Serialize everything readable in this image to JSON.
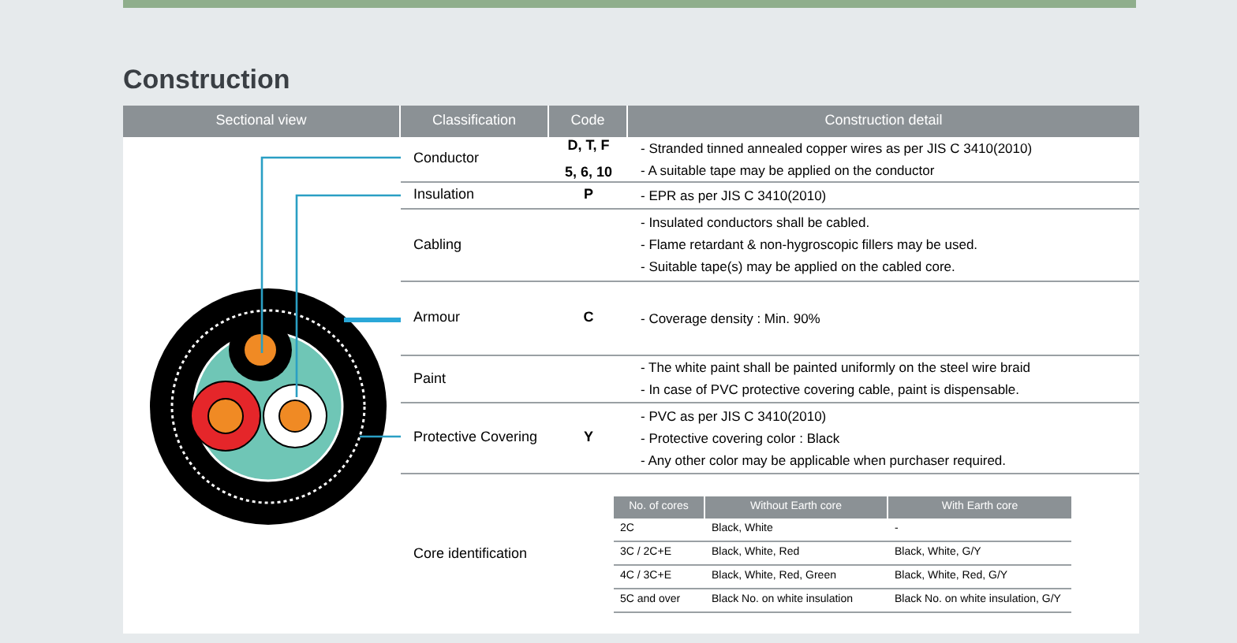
{
  "heading": "Construction",
  "table": {
    "columns": [
      "Sectional view",
      "Classification",
      "Code",
      "Construction detail"
    ],
    "rows": [
      {
        "classification": "Conductor",
        "code": [
          "D, T, F",
          "5, 6, 10"
        ],
        "detail": [
          "- Stranded tinned annealed copper wires as per JIS C 3410(2010)",
          "- A suitable tape may be applied on the conductor"
        ]
      },
      {
        "classification": "Insulation",
        "code": [
          "P"
        ],
        "detail": [
          "- EPR as per JIS C 3410(2010)"
        ]
      },
      {
        "classification": "Cabling",
        "code": [],
        "detail": [
          "- Insulated conductors shall be cabled.",
          "- Flame retardant & non-hygroscopic fillers may be used.",
          "- Suitable tape(s) may be applied on the cabled core."
        ]
      },
      {
        "classification": "Armour",
        "code": [
          "C"
        ],
        "detail": [
          "- Coverage density : Min. 90%"
        ]
      },
      {
        "classification": "Paint",
        "code": [],
        "detail": [
          "- The white paint shall be painted uniformly on the steel wire braid",
          "- In case of PVC protective covering cable, paint is dispensable."
        ]
      },
      {
        "classification": "Protective Covering",
        "code": [
          "Y"
        ],
        "detail": [
          "- PVC as per JIS C 3410(2010)",
          "- Protective covering color : Black",
          "- Any other color may be applicable when purchaser required."
        ]
      },
      {
        "classification": "Core identification",
        "code": [],
        "core_table": {
          "columns": [
            "No. of cores",
            "Without  Earth core",
            "With Earth core"
          ],
          "rows": [
            [
              "2C",
              "Black, White",
              "-"
            ],
            [
              "3C / 2C+E",
              "Black, White, Red",
              "Black, White, G/Y"
            ],
            [
              "4C / 3C+E",
              "Black, White, Red, Green",
              "Black, White, Red, G/Y"
            ],
            [
              "5C and over",
              "Black No. on white insulation",
              "Black No. on white insulation, G/Y"
            ]
          ]
        }
      }
    ]
  }
}
